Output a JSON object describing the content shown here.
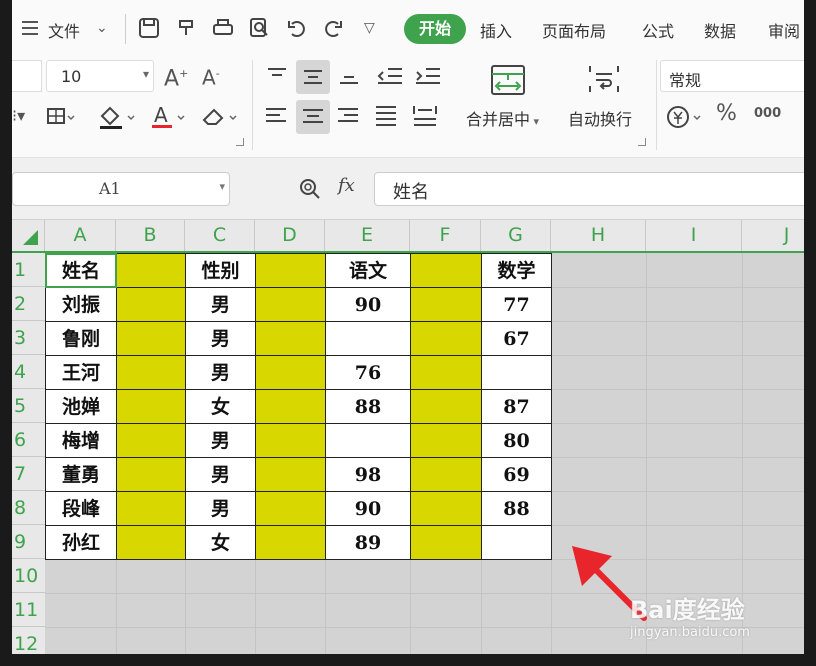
{
  "ribbon": {
    "file_menu": "文件",
    "tabs": [
      "开始",
      "插入",
      "页面布局",
      "公式",
      "数据",
      "审阅"
    ],
    "font_size": "10",
    "merge_label": "合并居中",
    "wrap_label": "自动换行",
    "number_format": "常规",
    "percent_symbol": "%",
    "thousands_symbol": "000"
  },
  "formula_bar": {
    "name_box": "A1",
    "fx": "fx",
    "content": "姓名"
  },
  "sheet": {
    "columns": [
      "A",
      "B",
      "C",
      "D",
      "E",
      "F",
      "G",
      "H",
      "I",
      "J"
    ],
    "rows": [
      "1",
      "2",
      "3",
      "4",
      "5",
      "6",
      "7",
      "8",
      "9",
      "10",
      "11",
      "12"
    ],
    "headers": {
      "name": "姓名",
      "gender": "性别",
      "chinese": "语文",
      "math": "数学"
    },
    "records": [
      {
        "name": "刘振",
        "gender": "男",
        "chinese": "90",
        "math": "77"
      },
      {
        "name": "鲁刚",
        "gender": "男",
        "chinese": "",
        "math": "67"
      },
      {
        "name": "王河",
        "gender": "男",
        "chinese": "76",
        "math": ""
      },
      {
        "name": "池婵",
        "gender": "女",
        "chinese": "88",
        "math": "87"
      },
      {
        "name": "梅增",
        "gender": "男",
        "chinese": "",
        "math": "80"
      },
      {
        "name": "董勇",
        "gender": "男",
        "chinese": "98",
        "math": "69"
      },
      {
        "name": "段峰",
        "gender": "男",
        "chinese": "90",
        "math": "88"
      },
      {
        "name": "孙红",
        "gender": "女",
        "chinese": "89",
        "math": ""
      }
    ]
  },
  "watermark": {
    "brand": "Bai度经验",
    "url": "jingyan.baidu.com"
  },
  "colors": {
    "accent": "#3fa34d",
    "highlight": "#d8d800",
    "arrow": "#e8252a"
  }
}
